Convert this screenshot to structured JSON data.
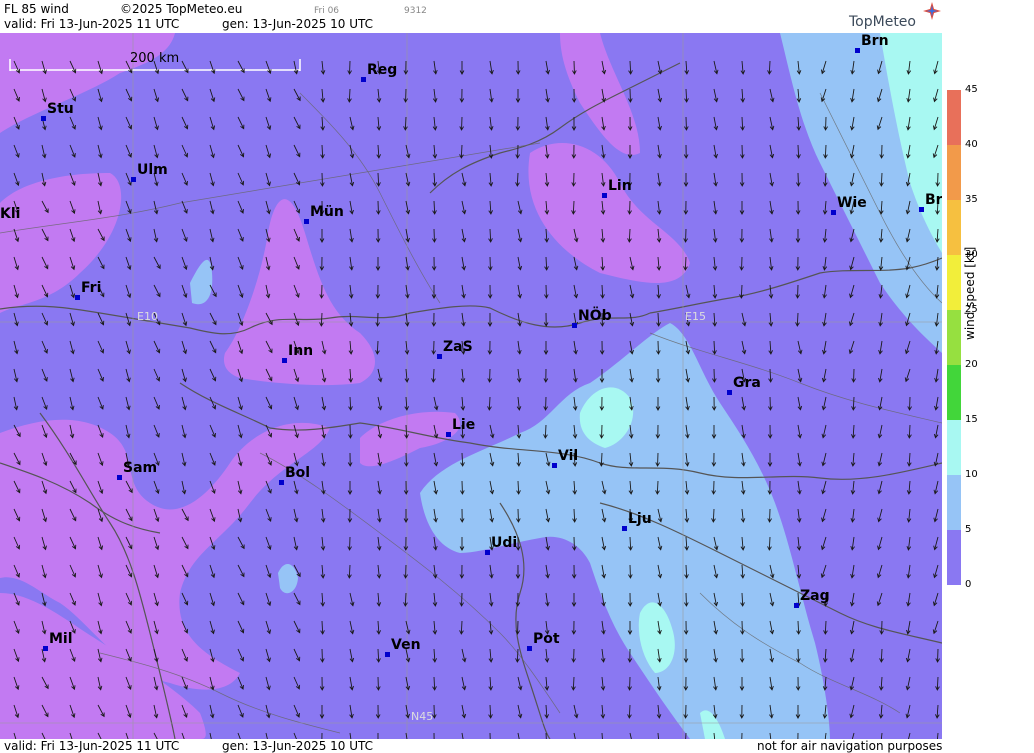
{
  "header": {
    "title": "FL 85 wind",
    "copyright": "©2025 TopMeteo.eu",
    "small_day": "Fri 06",
    "small_code": "9312",
    "valid": "valid:  Fri  13-Jun-2025  11 UTC",
    "gen": "gen: 13-Jun-2025 10 UTC"
  },
  "footer": {
    "valid": "valid:  Fri  13-Jun-2025  11 UTC",
    "gen": "gen: 13-Jun-2025 10 UTC",
    "note": "not for air navigation purposes"
  },
  "logo": "TopMeteo",
  "scale_bar": "200 km",
  "grid_labels": {
    "e10": "E10",
    "e15": "E15",
    "n45": "N45"
  },
  "legend": {
    "title": "wind speed [kt]",
    "ticks": [
      "45",
      "40",
      "35",
      "30",
      "25",
      "20",
      "15",
      "10",
      "5",
      "0"
    ],
    "colors": [
      "#e8705a",
      "#f29a4a",
      "#f6c040",
      "#f2ee3a",
      "#96e040",
      "#42d63a",
      "#a8f8f2",
      "#96c4f6",
      "#8a78f2",
      "#c27af2"
    ]
  },
  "cities": [
    {
      "name": "Stu"
    },
    {
      "name": "Ulm"
    },
    {
      "name": "Kli"
    },
    {
      "name": "Fri"
    },
    {
      "name": "Reg"
    },
    {
      "name": "Mün"
    },
    {
      "name": "Inn"
    },
    {
      "name": "ZaS"
    },
    {
      "name": "NÖb"
    },
    {
      "name": "Lin"
    },
    {
      "name": "Brn"
    },
    {
      "name": "Wie"
    },
    {
      "name": "Br"
    },
    {
      "name": "Gra"
    },
    {
      "name": "Lie"
    },
    {
      "name": "Vil"
    },
    {
      "name": "Sam"
    },
    {
      "name": "Bol"
    },
    {
      "name": "Lju"
    },
    {
      "name": "Udi"
    },
    {
      "name": "Zag"
    },
    {
      "name": "Mil"
    },
    {
      "name": "Ven"
    },
    {
      "name": "Pot"
    }
  ]
}
